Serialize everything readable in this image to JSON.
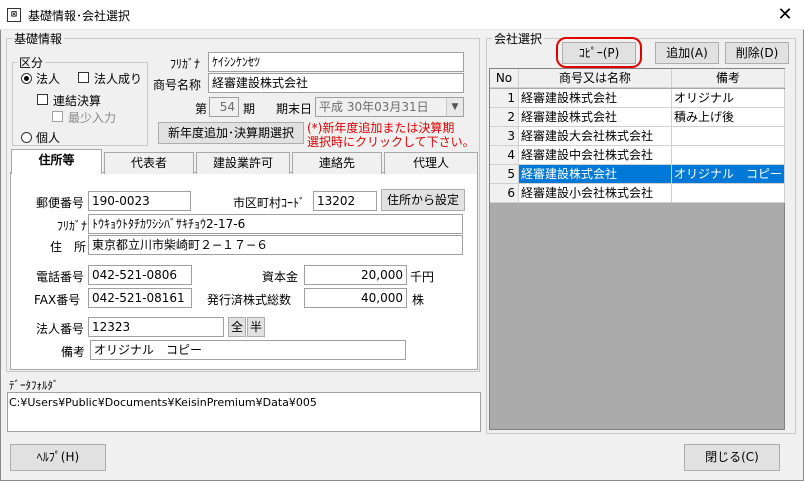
{
  "window": {
    "title": "基礎情報･会社選択",
    "app_icon": "window-icon",
    "close_glyph": "✕"
  },
  "basic": {
    "group_label": "基礎情報",
    "kubun": {
      "label": "区分",
      "hojin": "法人",
      "hojin_nari": "法人成り",
      "renketsu": "連結決算",
      "saisho": "最少入力",
      "kojin": "個人"
    },
    "furigana_label": "ﾌﾘｶﾞﾅ",
    "furigana_value": "ｹｲｼﾝｹﾝｾﾂ",
    "shogo_label": "商号名称",
    "shogo_value": "経審建設株式会社",
    "dai_label": "第",
    "ki_value": "54",
    "ki_label": "期",
    "kimatsu_label": "期末日",
    "kimatsu_value": "平成 30年03月31日",
    "new_year_button": "新年度追加･決算期選択",
    "note_line1": "(*)新年度追加または決算期",
    "note_line2": "選択時にクリックして下さい。"
  },
  "tabs": [
    "住所等",
    "代表者",
    "建設業許可",
    "連絡先",
    "代理人"
  ],
  "address": {
    "postal_label": "郵便番号",
    "postal_value": "190-0023",
    "city_code_label": "市区町村ｺｰﾄﾞ",
    "city_code_value": "13202",
    "from_address_button": "住所から設定",
    "furigana_label": "ﾌﾘｶﾞﾅ",
    "furigana_value": "ﾄｳｷｮｳﾄﾀﾁｶﾜｼｼﾊﾞｻｷﾁｮｳ2-17-6",
    "address_label": "住　所",
    "address_value": "東京都立川市柴崎町２−１７−６",
    "phone_label": "電話番号",
    "phone_value": "042-521-0806",
    "capital_label": "資本金",
    "capital_value": "20,000",
    "capital_unit": "千円",
    "fax_label": "FAX番号",
    "fax_value": "042-521-08161",
    "shares_label": "発行済株式総数",
    "shares_value": "40,000",
    "shares_unit": "株",
    "corp_no_label": "法人番号",
    "corp_no_value": "12323",
    "zen_button": "全",
    "han_button": "半",
    "biko_label": "備考",
    "biko_value": "オリジナル　コピー"
  },
  "data_folder": {
    "label": "ﾃﾞｰﾀﾌｫﾙﾀﾞ",
    "path": "C:¥Users¥Public¥Documents¥KeisinPremium¥Data¥005"
  },
  "company_select": {
    "group_label": "会社選択",
    "copy_button": "ｺﾋﾟｰ(P)",
    "add_button": "追加(A)",
    "delete_button": "削除(D)",
    "headers": [
      "No",
      "商号又は名称",
      "備考"
    ],
    "rows": [
      {
        "no": "1",
        "name": "経審建設株式会社",
        "note": "オリジナル"
      },
      {
        "no": "2",
        "name": "経審建設株式会社",
        "note": "積み上げ後"
      },
      {
        "no": "3",
        "name": "経審建設大会社株式会社",
        "note": ""
      },
      {
        "no": "4",
        "name": "経審建設中会社株式会社",
        "note": ""
      },
      {
        "no": "5",
        "name": "経審建設株式会社",
        "note": "オリジナル　コピー"
      },
      {
        "no": "6",
        "name": "経審建設小会社株式会社",
        "note": ""
      }
    ],
    "selected_row": 4,
    "highlight_color": "#0078d7",
    "copy_ring_color": "#e00000"
  },
  "footer": {
    "help_button": "ﾍﾙﾌﾟ(H)",
    "close_button": "閉じる(C)"
  }
}
